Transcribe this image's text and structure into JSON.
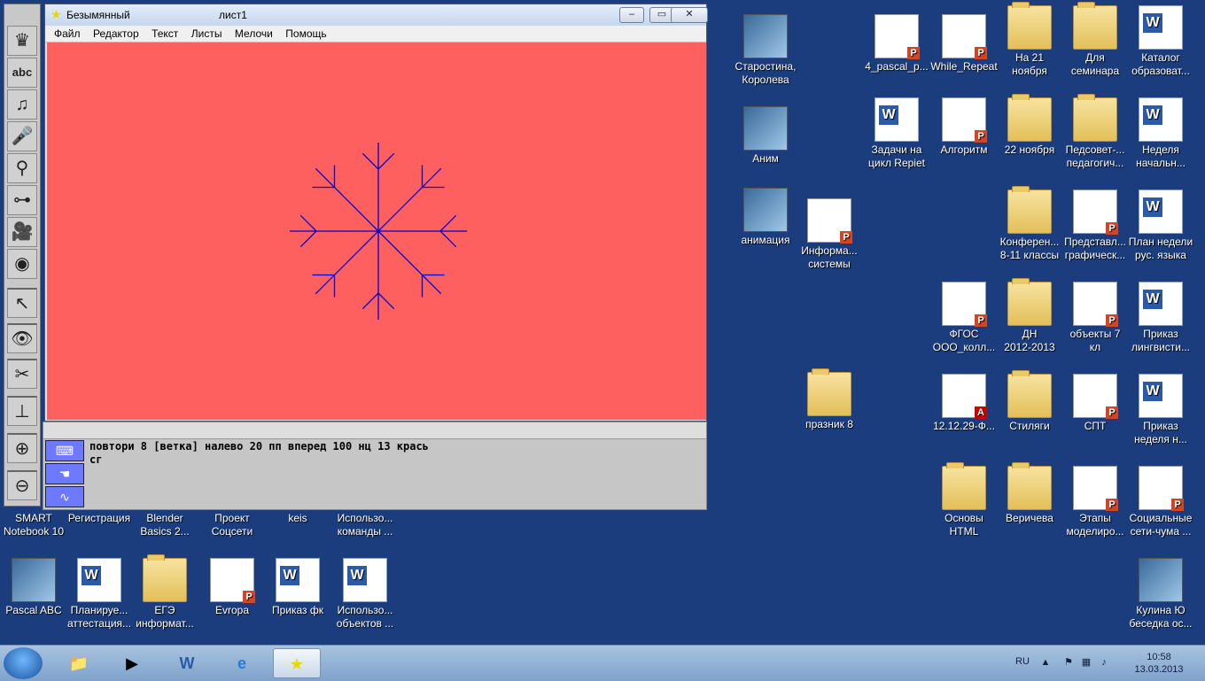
{
  "window": {
    "title": "Безымянный",
    "sheet": "лист1",
    "minimize": "‒",
    "maximize": "▭",
    "close": "✕"
  },
  "menu": [
    "Файл",
    "Редактор",
    "Текст",
    "Листы",
    "Мелочи",
    "Помощь"
  ],
  "toolbar_icons": [
    "turtle-icon",
    "abc-text-icon",
    "music-note-icon",
    "microphone-icon",
    "satellite-dish-icon",
    "slider-icon",
    "movie-camera-icon",
    "cd-music-icon",
    "pointer-arrow-icon",
    "eye-icon",
    "scissors-icon",
    "stamp-icon",
    "zoom-in-icon",
    "zoom-out-icon"
  ],
  "command": {
    "line1": "повтори 8 [ветка] налево 20 пп вперед 100 нц 13 крась",
    "line2": "сг"
  },
  "canvas_color": "#fe5f5f",
  "drawing_color": "#0000cc",
  "desktop": {
    "col_right": [
      {
        "label": "Старостина,\nКоролева",
        "type": "imgthumb"
      },
      {
        "label": "Аним",
        "type": "imgthumb"
      },
      {
        "label": "анимация",
        "type": "imgthumb"
      },
      {
        "label": "Информа...\nсистемы",
        "type": "pres"
      },
      {
        "label": "празник 8",
        "type": "folder"
      },
      {
        "label": "4_pascal_p...",
        "type": "pres"
      },
      {
        "label": "While_Repeat",
        "type": "pres"
      },
      {
        "label": "На 21\nноября",
        "type": "folder"
      },
      {
        "label": "Для\nсеминара",
        "type": "folder"
      },
      {
        "label": "Каталог\nобразоват...",
        "type": "wdoc"
      },
      {
        "label": "Задачи на\nцикл Repiet",
        "type": "wdoc"
      },
      {
        "label": "Алгоритм",
        "type": "pres"
      },
      {
        "label": "22 ноября",
        "type": "folder"
      },
      {
        "label": "Педсовет-...\nпедагогич...",
        "type": "folder"
      },
      {
        "label": "Неделя\nначальн...",
        "type": "wdoc"
      },
      {
        "label": "Конферен...\n8-11 классы",
        "type": "folder"
      },
      {
        "label": "Представл...\nграфическ...",
        "type": "pres"
      },
      {
        "label": "План недели\nрус. языка",
        "type": "wdoc"
      },
      {
        "label": "ФГОС\nООО_колл...",
        "type": "pres"
      },
      {
        "label": "ДН\n2012-2013",
        "type": "folder"
      },
      {
        "label": "объекты 7\nкл",
        "type": "pres"
      },
      {
        "label": "Приказ\nлингвисти...",
        "type": "wdoc"
      },
      {
        "label": "12.12.29-Ф...",
        "type": "pdf"
      },
      {
        "label": "Стиляги",
        "type": "folder"
      },
      {
        "label": "СПТ",
        "type": "pres"
      },
      {
        "label": "Приказ\nнеделя н...",
        "type": "wdoc"
      },
      {
        "label": "Основы\nHTML",
        "type": "folder"
      },
      {
        "label": "Веричева",
        "type": "folder"
      },
      {
        "label": "Этапы\nмоделиро...",
        "type": "pres"
      },
      {
        "label": "Социальные\nсети-чума ...",
        "type": "pres"
      },
      {
        "label": "Кулина Ю\nбеседка ос...",
        "type": "imgthumb"
      }
    ],
    "row_bottom1": [
      {
        "label": "SMART\nNotebook 10"
      },
      {
        "label": "Регистрация"
      },
      {
        "label": "Blender\nBasics 2..."
      },
      {
        "label": "Проект\nСоцсети"
      },
      {
        "label": "keis"
      },
      {
        "label": "Использо...\nкоманды ..."
      }
    ],
    "row_bottom2": [
      {
        "label": "Pascal ABC",
        "type": "imgthumb"
      },
      {
        "label": "Планируе...\nаттестация...",
        "type": "wdoc"
      },
      {
        "label": "ЕГЭ\nинформат...",
        "type": "folder"
      },
      {
        "label": "Evropa",
        "type": "pres"
      },
      {
        "label": "Приказ фк",
        "type": "wdoc"
      },
      {
        "label": "Использо...\nобъектов ...",
        "type": "wdoc"
      }
    ]
  },
  "taskbar": {
    "items": [
      "explorer-icon",
      "media-player-icon",
      "word-icon",
      "internet-explorer-icon",
      "logo-world-icon"
    ],
    "lang": "RU",
    "time": "10:58",
    "date": "13.03.2013"
  }
}
